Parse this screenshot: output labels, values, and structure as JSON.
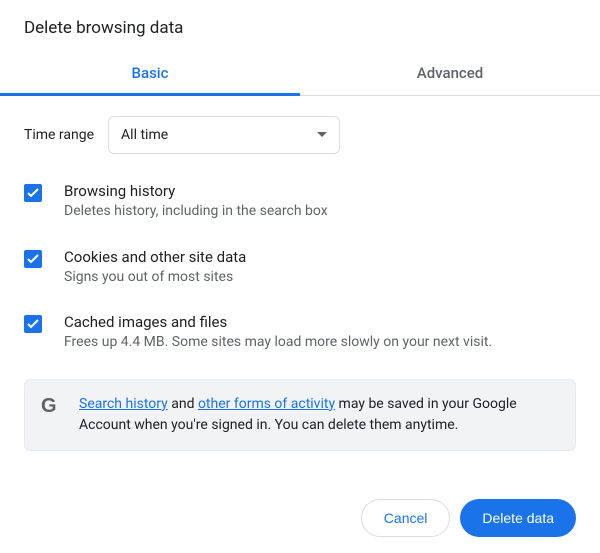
{
  "title": "Delete browsing data",
  "tabs": {
    "basic": "Basic",
    "advanced": "Advanced"
  },
  "time": {
    "label": "Time range",
    "selected": "All time"
  },
  "options": [
    {
      "title": "Browsing history",
      "desc": "Deletes history, including in the search box",
      "checked": true
    },
    {
      "title": "Cookies and other site data",
      "desc": "Signs you out of most sites",
      "checked": true
    },
    {
      "title": "Cached images and files",
      "desc": "Frees up 4.4 MB. Some sites may load more slowly on your next visit.",
      "checked": true
    }
  ],
  "notice": {
    "link1": "Search history",
    "mid1": " and ",
    "link2": "other forms of activity",
    "rest": " may be saved in your Google Account when you're signed in. You can delete them anytime."
  },
  "footer": {
    "cancel": "Cancel",
    "confirm": "Delete data"
  }
}
